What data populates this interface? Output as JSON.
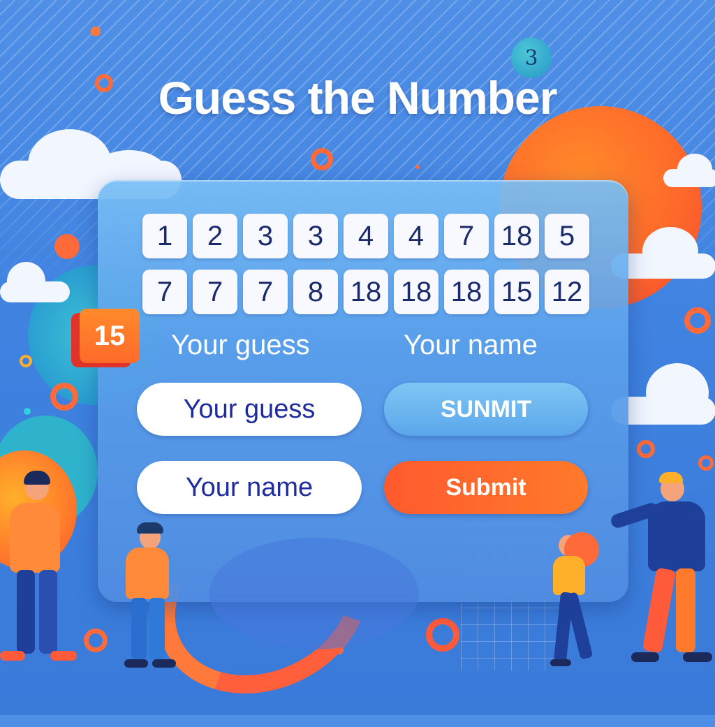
{
  "title": "Guess the Number",
  "badge_number": "15",
  "coin_number": "3",
  "tiles": {
    "row1": [
      "1",
      "2",
      "3",
      "3",
      "4",
      "4",
      "7",
      "18",
      "5"
    ],
    "row2": [
      "7",
      "7",
      "7",
      "8",
      "18",
      "18",
      "18",
      "15",
      "12"
    ]
  },
  "labels": {
    "guess_label": "Your guess",
    "name_label": "Your name"
  },
  "inputs": {
    "guess_value": "Your guess",
    "name_value": "Your name"
  },
  "buttons": {
    "submit_top": "SUNMIT",
    "submit_bottom": "Submit"
  },
  "colors": {
    "background": "#4f8fe6",
    "accent_orange": "#ff6a2a",
    "panel": "#6aa8ec",
    "input_text": "#1e2c9e"
  }
}
